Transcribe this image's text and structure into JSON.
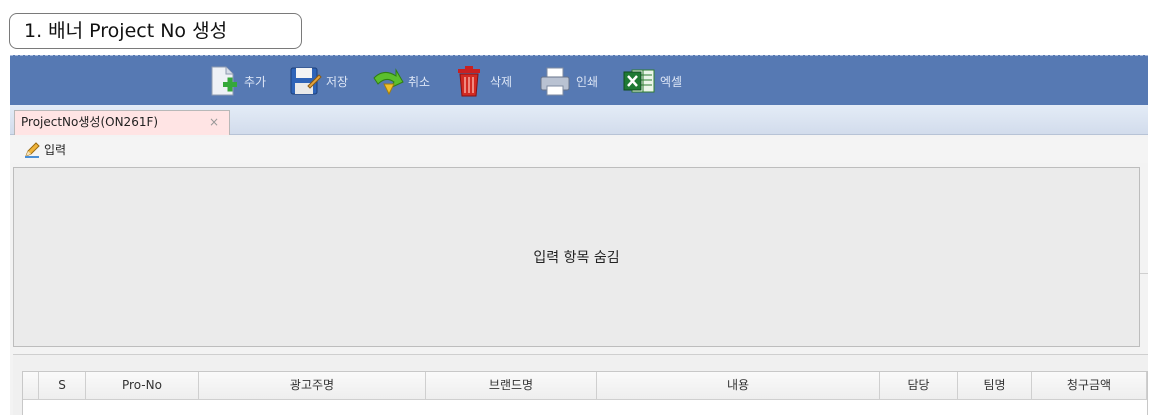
{
  "banner": {
    "label": "1. 배너 Project No 생성"
  },
  "toolbar": {
    "items": [
      {
        "label": "추가",
        "icon": "add-document-icon"
      },
      {
        "label": "저장",
        "icon": "save-icon"
      },
      {
        "label": "취소",
        "icon": "cancel-arrow-icon"
      },
      {
        "label": "삭제",
        "icon": "trash-icon"
      },
      {
        "label": "인쇄",
        "icon": "printer-icon"
      },
      {
        "label": "엑셀",
        "icon": "excel-icon"
      }
    ]
  },
  "tabs": [
    {
      "label": "ProjectNo생성(ON261F)",
      "close": "×"
    }
  ],
  "input_section": {
    "label": "입력",
    "icon": "pencil-icon"
  },
  "hidden_panel": {
    "text": "입력 항목 숨김"
  },
  "grid": {
    "columns": [
      "",
      "S",
      "Pro-No",
      "광고주명",
      "브랜드명",
      "내용",
      "담당",
      "팀명",
      "청구금액"
    ]
  },
  "colors": {
    "toolbar_bg": "#5679b3",
    "tab_active_bg": "#ffe4e4",
    "panel_bg": "#ebebeb"
  }
}
